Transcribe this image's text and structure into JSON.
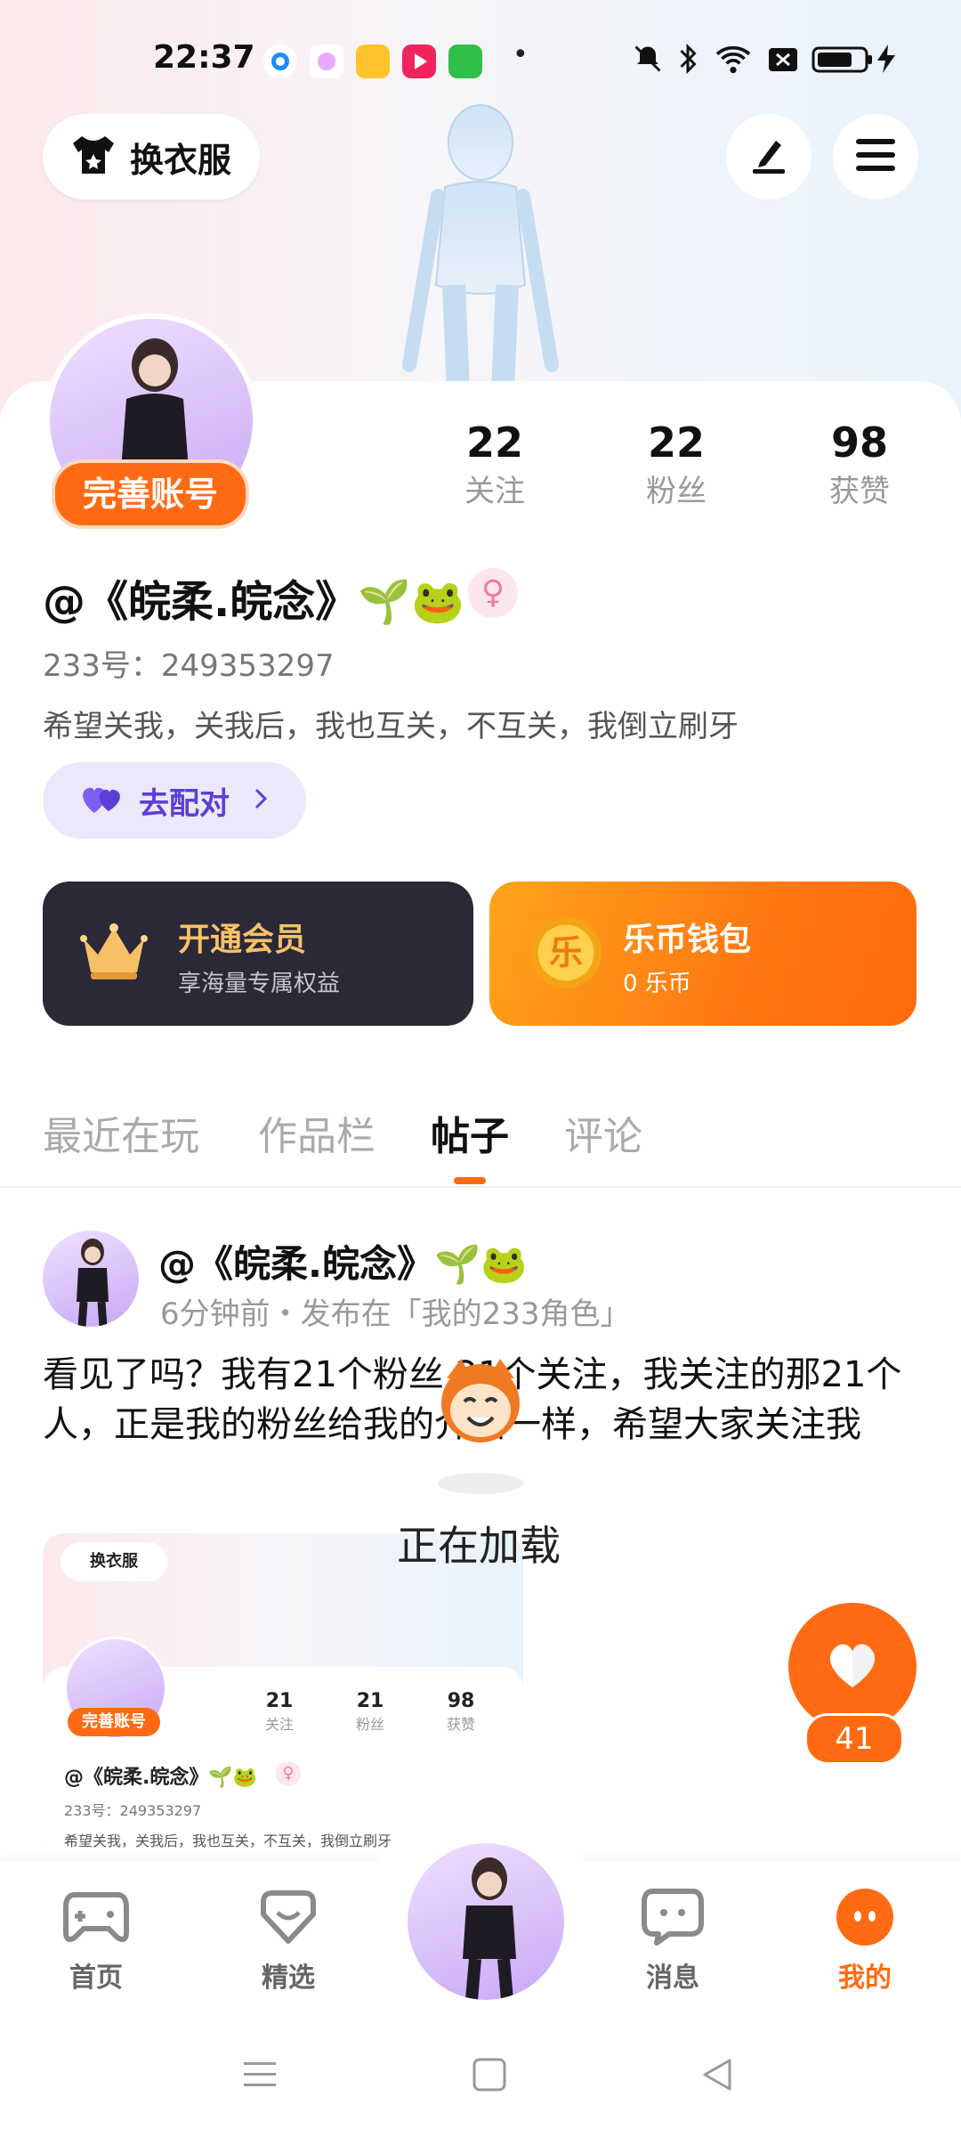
{
  "status_bar": {
    "time": "22:37",
    "dot": "•"
  },
  "top_bar": {
    "dress_up_label": "换衣服",
    "edit_icon": "pen-icon",
    "menu_icon": "menu-icon"
  },
  "profile": {
    "complete_badge": "完善账号",
    "stats": [
      {
        "value": "22",
        "label": "关注"
      },
      {
        "value": "22",
        "label": "粉丝"
      },
      {
        "value": "98",
        "label": "获赞"
      }
    ],
    "username": "@《皖柔.皖念》🌱🐸",
    "gender_symbol": "♀",
    "id_line": "233号：249353297",
    "bio": "希望关我，关我后，我也互关，不互关，我倒立刷牙",
    "match_label": "去配对"
  },
  "cards": {
    "vip_title": "开通会员",
    "vip_sub": "享海量专属权益",
    "coin_glyph": "乐",
    "coin_title": "乐币钱包",
    "coin_sub": "0 乐币"
  },
  "tabs": [
    "最近在玩",
    "作品栏",
    "帖子",
    "评论"
  ],
  "post": {
    "user": "@《皖柔.皖念》🌱🐸",
    "meta": "6分钟前・发布在「我的233角色」",
    "text": "看见了吗？我有21个粉丝 21个关注，我关注的那21个人，正是我的粉丝给我的介绍一样，希望大家关注我",
    "loading": "正在加载",
    "like_count": "41",
    "thumb": {
      "dress_up": "换衣服",
      "badge": "完善账号",
      "stats": [
        {
          "value": "21",
          "label": "关注"
        },
        {
          "value": "21",
          "label": "粉丝"
        },
        {
          "value": "98",
          "label": "获赞"
        }
      ],
      "username": "@《皖柔.皖念》🌱🐸",
      "gender_symbol": "♀",
      "id_line": "233号：249353297",
      "bio": "希望关我，关我后，我也互关，不互关，我倒立刷牙"
    }
  },
  "bottom_nav": [
    {
      "label": "首页",
      "icon": "gamepad-icon"
    },
    {
      "label": "精选",
      "icon": "heart-box-icon"
    },
    {
      "label": "消息",
      "icon": "chat-icon"
    },
    {
      "label": "我的",
      "icon": "me-icon"
    }
  ],
  "colors": {
    "accent": "#ff6a13",
    "purple": "#6a4fd6",
    "vip_dark": "#2b2838"
  }
}
